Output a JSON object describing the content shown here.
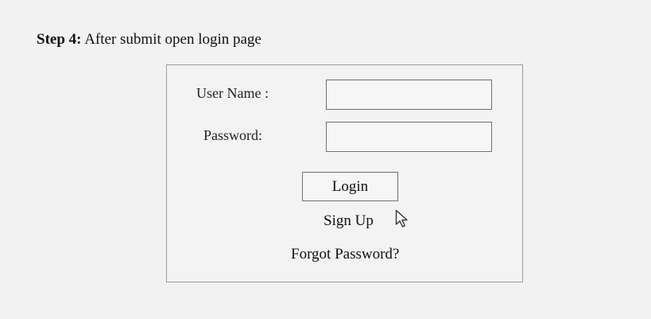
{
  "heading": {
    "step_label": "Step 4:",
    "step_text": "After submit open login page"
  },
  "login_form": {
    "username_label": "User Name :",
    "username_value": "",
    "password_label": "Password:",
    "password_value": "",
    "login_button_label": "Login",
    "signup_link_label": "Sign Up",
    "forgot_password_label": "Forgot Password?"
  },
  "icons": {
    "cursor": "mouse-pointer-icon"
  },
  "colors": {
    "background": "#f2f2f2",
    "panel_border": "#9a9a9a",
    "input_border": "#707070"
  }
}
